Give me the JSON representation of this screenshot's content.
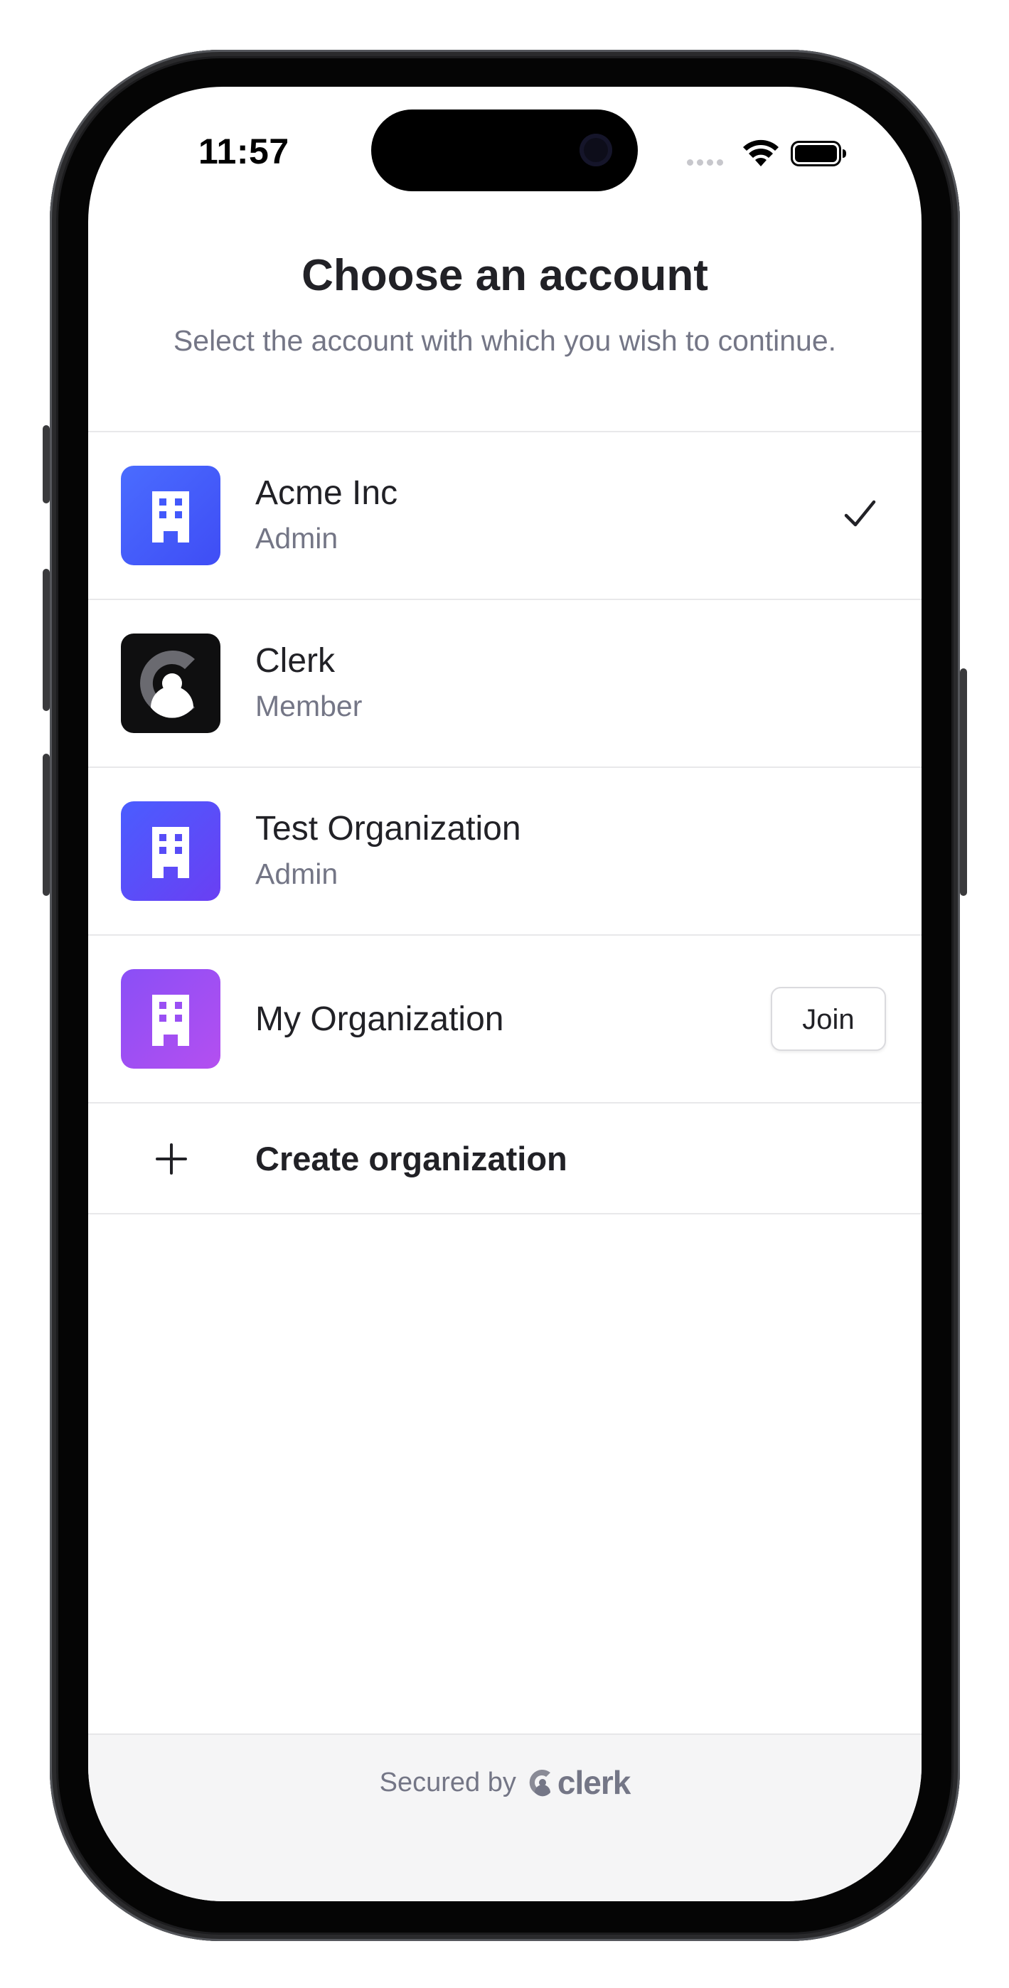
{
  "status_bar": {
    "time": "11:57"
  },
  "header": {
    "title": "Choose an account",
    "subtitle": "Select the account with which you wish to continue."
  },
  "accounts": [
    {
      "name": "Acme Inc",
      "role": "Admin",
      "icon": "building-icon",
      "selected": true,
      "color": "#4f63ff"
    },
    {
      "name": "Clerk",
      "role": "Member",
      "icon": "clerk-logo-icon",
      "selected": false,
      "color": "#111111"
    },
    {
      "name": "Test Organization",
      "role": "Admin",
      "icon": "building-icon",
      "selected": false,
      "color": "#5b4cf6"
    },
    {
      "name": "My Organization",
      "role": "",
      "icon": "building-icon",
      "selected": false,
      "color": "#9b4bf2",
      "action": "Join"
    }
  ],
  "create_organization": {
    "label": "Create organization",
    "icon": "plus-icon"
  },
  "footer": {
    "secured_by": "Secured by",
    "brand": "clerk"
  },
  "colors": {
    "text": "#212126",
    "muted": "#747686",
    "divider": "#e8e8ea"
  }
}
